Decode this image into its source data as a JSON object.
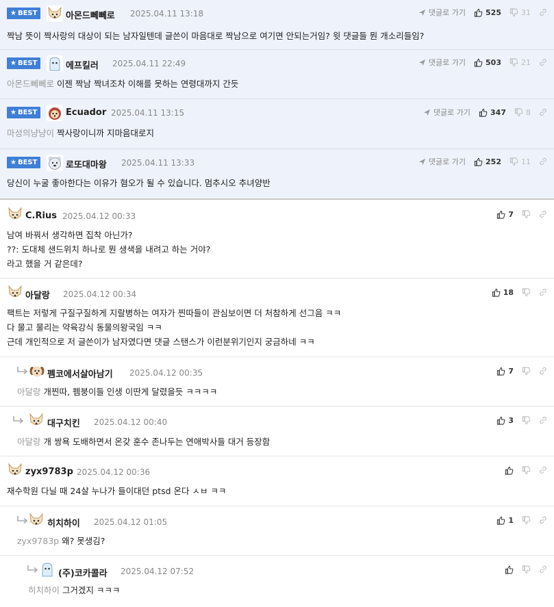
{
  "labels": {
    "best": "BEST",
    "reply_to": "댓글로 가기"
  },
  "colors": {
    "best_badge": "#3f7fd6",
    "best_row_bg": "#eef3fb",
    "mention": "#999999"
  },
  "best_comments": [
    {
      "nick": "아몬드뻬뻬로",
      "date": "2025.04.11 13:18",
      "likes": "525",
      "dislikes": "31",
      "avatar": "dog-avatar",
      "mention": "",
      "lines": [
        "짝남 뜻이 짝사랑의 대상이 되는 남자일텐데 글쓴이 마음대로 짝남으로 여기면 안되는거임? 윗 댓글들 뭔 개소리들임?"
      ]
    },
    {
      "nick": "에프킬러",
      "date": "2025.04.11 22:49",
      "likes": "503",
      "dislikes": "21",
      "avatar": "ghost-avatar",
      "mention": "아몬드뻬뻬로",
      "lines": [
        "이젠 짝남 짝녀조차 이해를 못하는 연령대까지 간듯"
      ]
    },
    {
      "nick": "Ecuador",
      "date": "2025.04.11 13:15",
      "likes": "347",
      "dislikes": "8",
      "avatar": "fox-avatar",
      "mention": "마성의냥냥이",
      "lines": [
        "짝사랑이니까 지마음대로지"
      ]
    },
    {
      "nick": "로또대마왕",
      "date": "2025.04.11 13:33",
      "likes": "252",
      "dislikes": "11",
      "avatar": "bear-avatar",
      "mention": "",
      "lines": [
        "당신이 누굴 좋아한다는 이유가 혐오가 될 수 있습니다. 멈추시오 추녀양반"
      ]
    }
  ],
  "comments": [
    {
      "nick": "C.Rius",
      "date": "2025.04.12 00:33",
      "likes": "7",
      "mention": "",
      "avatar": "dog-avatar",
      "lines": [
        "남여 바꿔서 생각하면 집착 아닌가?",
        "??: 도대체 샌드위치 하나로 뭔 생색을 내려고 하는 거야?",
        "라고 했을 거 같은데?"
      ]
    },
    {
      "nick": "아달랑",
      "date": "2025.04.12 00:34",
      "likes": "18",
      "mention": "",
      "avatar": "dog-avatar",
      "lines": [
        "팩트는 저렇게 구질구질하게 지랄병하는 여자가 찐따들이 관심보이면 더 처참하게 선그음 ㅋㅋ",
        "다 물고 물리는 약육강식 동물의왕국임 ㅋㅋ",
        "근데 개인적으로 저 글쓴이가 남자였다면 댓글 스탠스가 이런분위기인지 궁금하네 ㅋㅋ"
      ]
    },
    {
      "nick": "펨코에서살아남기",
      "date": "2025.04.12 00:35",
      "likes": "7",
      "mention": "아달랑",
      "avatar": "puppy-avatar",
      "lines": [
        "개찐따, 펨붕이들 인생 이딴게 달렸을듯 ㅋㅋㅋㅋ"
      ]
    },
    {
      "nick": "대구치킨",
      "date": "2025.04.12 00:40",
      "likes": "3",
      "mention": "아달랑",
      "avatar": "dog-avatar",
      "lines": [
        "개 쌍욕 도배하면서 온갖 훈수 존나두는 연애박사들 대거 등장함"
      ]
    },
    {
      "nick": "zyx9783p",
      "date": "2025.04.12 00:36",
      "likes": "",
      "mention": "",
      "avatar": "dog-avatar",
      "lines": [
        "재수학원 다닐 때 24살 누나가 들이대던 ptsd 온다 ㅅㅂ ㅋㅋ"
      ]
    },
    {
      "nick": "히치하이",
      "date": "2025.04.12 01:05",
      "likes": "1",
      "mention": "zyx9783p",
      "avatar": "dog-avatar",
      "lines": [
        "왜? 못생김?"
      ]
    },
    {
      "nick": "(주)코카콜라",
      "date": "2025.04.12 07:52",
      "likes": "",
      "mention": "히치하이",
      "avatar": "ghost-avatar",
      "lines": [
        "그거겠지 ㅋㅋㅋ"
      ]
    }
  ]
}
